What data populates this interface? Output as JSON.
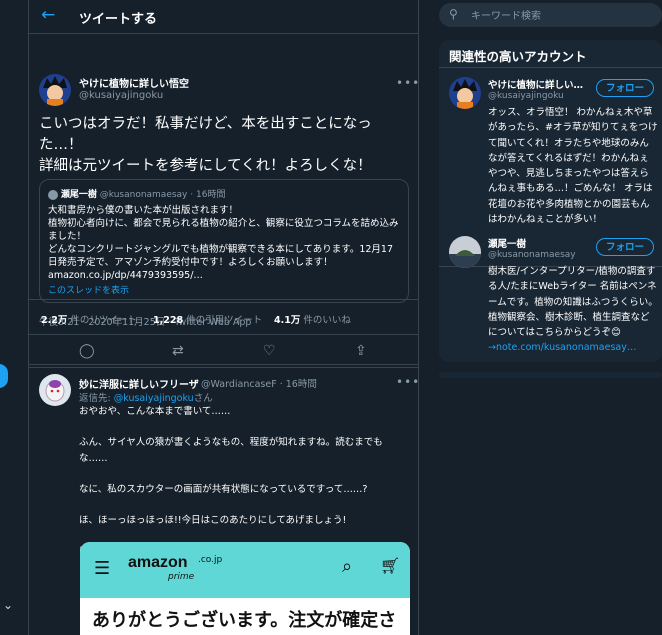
{
  "header": {
    "back_icon": "←",
    "title": "ツイートする"
  },
  "tweet": {
    "author_name": "やけに植物に詳しい悟空",
    "author_handle": "@kusaiyajingoku",
    "more_icon": "•••",
    "text": "こいつはオラだ！私事だけど、本を出すことになった…！\n詳細は元ツイートを参考にしてくれ！よろしくな！",
    "quote": {
      "author_name": "瀬尾一樹",
      "author_handle": "@kusanonamaesay",
      "time": "· 16時間",
      "text": "大和書房から僕の書いた本が出版されます！\n植物初心者向けに、都会で見られる植物の紹介と、観察に役立つコラムを詰め込みました！\nどんなコンクリートジャングルでも植物が観察できる本にしてあります。12月17日発売予定で、アマゾン予約受付中です！よろしくお願いします！\namazon.co.jp/dp/4479393595/…",
      "thread_link": "このスレッドを表示"
    },
    "timestamp": "午後8:21 · 2020年11月25日 · Twitter Web App",
    "stats": {
      "retweets": "2.2万",
      "retweets_label": "件のリツイート",
      "quotes": "1,228",
      "quotes_label": "件の引用ツイート",
      "likes": "4.1万",
      "likes_label": "件のいいね"
    },
    "actions": {
      "reply_icon": "◯",
      "retweet_icon": "⇄",
      "like_icon": "♡",
      "share_icon": "⇪"
    }
  },
  "reply": {
    "author_name": "妙に洋服に詳しいフリーザ",
    "author_handle": "@WardiancaseF",
    "time": "· 16時間",
    "reply_to_prefix": "返信先: ",
    "reply_to_handle": "@kusaiyajingoku",
    "reply_to_suffix": "さん",
    "text": "おやおや、こんな本まで書いて……\n\nふん、サイヤ人の猿が書くようなもの、程度が知れますね。読むまでもな……\n\nなに、私のスカウターの画面が共有状態になっているですって……?\n\nほ、ほーっほっほっほ!!今日はこのあたりにしてあげましょう!\n\nほーっほっほっほ!",
    "image": {
      "logo": "amazon",
      "cojp": ".co.jp",
      "prime": "prime",
      "text": "ありがとうございます。注文が確定されました"
    }
  },
  "sidebar": {
    "search_placeholder": "キーワード検索",
    "related_title": "関連性の高いアカウント",
    "accounts": [
      {
        "name": "やけに植物に詳しい…",
        "handle": "@kusaiyajingoku",
        "follow_label": "フォロー",
        "bio": "オッス、オラ悟空！ わかんねぇ木や草があったら、#オラ草が知りてぇをつけて聞いてくれ！オラたちや地球のみんなが答えてくれるはずだ！わかんねぇやつや、見逃しちまったやつは答えらんねぇ事もある…！ごめんな！ オラは花壇のお花や多肉植物とかの園芸もんはわかんねぇことが多い！"
      },
      {
        "name": "瀬尾一樹",
        "handle": "@kusanonamaesay",
        "follow_label": "フォロー",
        "bio": "樹木医/インタープリター/植物の調査する人/たまにWebライター 名前はペンネームです。植物の知識はふつうくらい。 植物観察会、樹木診断、植生調査などについてはこちらからどうぞ😊",
        "link": "→note.com/kusanonamaesay…"
      }
    ]
  }
}
